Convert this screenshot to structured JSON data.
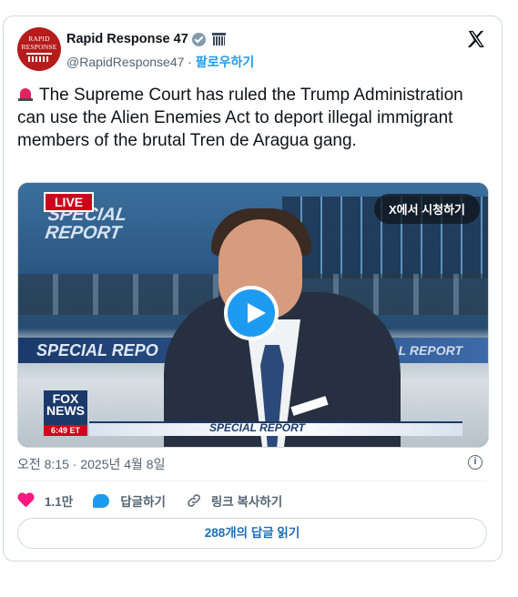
{
  "tweet": {
    "display_name": "Rapid Response 47",
    "handle": "@RapidResponse47",
    "separator": "·",
    "follow_label": "팔로우하기",
    "avatar_text": "RAPID RESPONSE",
    "text": "The Supreme Court has ruled the Trump Administration can use the Alien Enemies Act to deport illegal immigrant members of the brutal Tren de Aragua gang.",
    "timestamp": "오전 8:15 · 2025년 4월 8일"
  },
  "media": {
    "watch_on_x": "X에서 시청하기",
    "live_badge": "LIVE",
    "banner_top": "SPECIAL REPORT",
    "band_left": "SPECIAL REPO",
    "band_right": "SPECIAL REPORT",
    "lower_third": "SPECIAL REPORT",
    "fox_logo": "FOX NEWS",
    "fox_time": "6:49 ET"
  },
  "actions": {
    "like_count": "1.1만",
    "reply_label": "답글하기",
    "copy_link_label": "링크 복사하기",
    "read_replies": "288개의 답글 읽기"
  },
  "icons": [
    "siren-icon",
    "verified-badge-icon",
    "government-icon",
    "x-logo-icon",
    "play-icon",
    "info-icon",
    "heart-icon",
    "reply-icon",
    "link-icon"
  ],
  "colors": {
    "accent": "#1d9bf0",
    "like": "#f91880",
    "muted": "#536471"
  }
}
